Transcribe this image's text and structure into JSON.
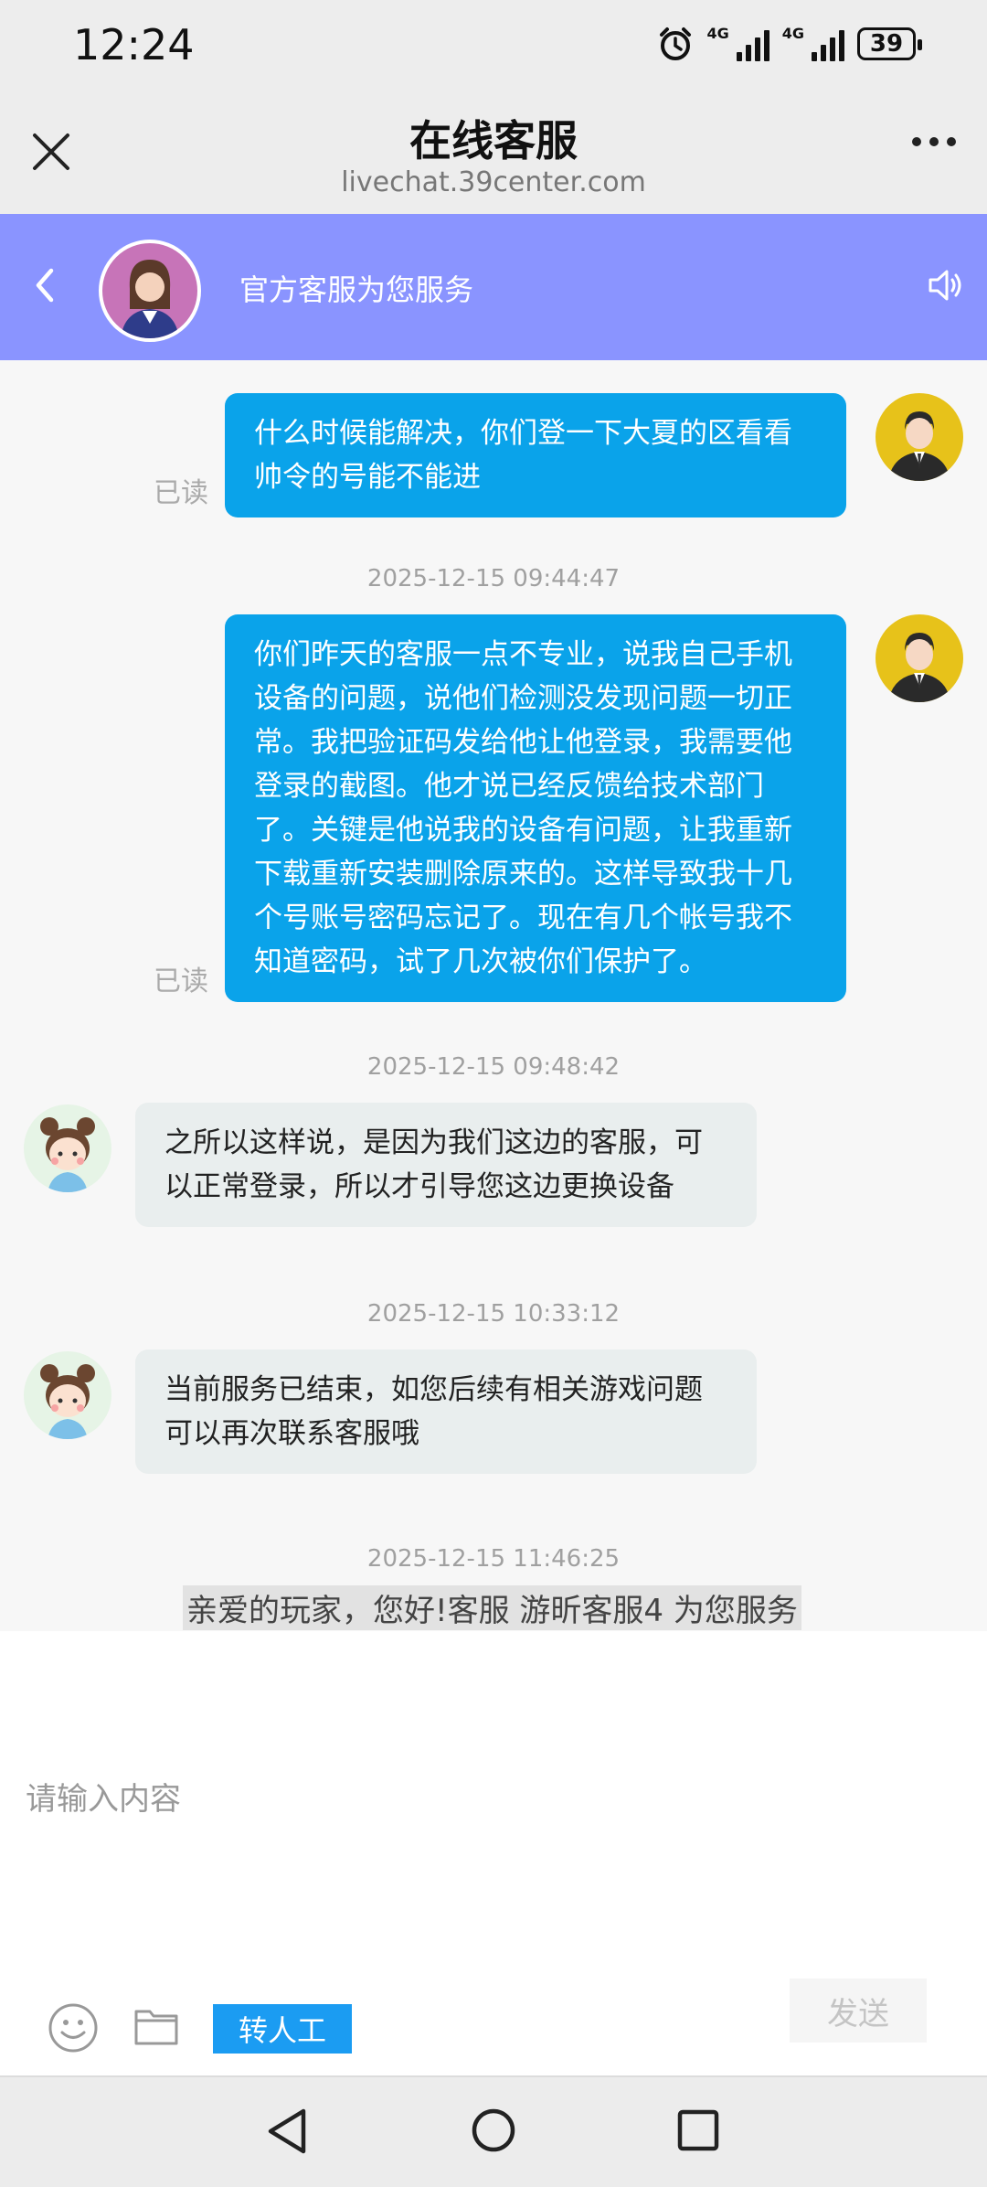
{
  "status_bar": {
    "time": "12:24",
    "network_1": "4G",
    "network_2": "4G",
    "battery": "39"
  },
  "browser": {
    "title": "在线客服",
    "url": "livechat.39center.com"
  },
  "chat_header": {
    "title": "官方客服为您服务"
  },
  "messages": [
    {
      "from": "user",
      "text": "什么时候能解决，你们登一下大夏的区看看帅令的号能不能进",
      "status": "已读"
    },
    {
      "timestamp": "2025-12-15 09:44:47"
    },
    {
      "from": "user",
      "text": "你们昨天的客服一点不专业，说我自己手机设备的问题，说他们检测没发现问题一切正常。我把验证码发给他让他登录，我需要他登录的截图。他才说已经反馈给技术部门了。关键是他说我的设备有问题，让我重新下载重新安装删除原来的。这样导致我十几个号账号密码忘记了。现在有几个帐号我不知道密码，试了几次被你们保护了。",
      "status": "已读"
    },
    {
      "timestamp": "2025-12-15 09:48:42"
    },
    {
      "from": "agent",
      "text": "之所以这样说，是因为我们这边的客服，可以正常登录，所以才引导您这边更换设备"
    },
    {
      "timestamp": "2025-12-15 10:33:12"
    },
    {
      "from": "agent",
      "text": "当前服务已结束，如您后续有相关游戏问题可以再次联系客服哦"
    },
    {
      "timestamp": "2025-12-15 11:46:25"
    },
    {
      "system": "亲爱的玩家，您好!客服 游昕客服4 为您服务"
    }
  ],
  "input": {
    "placeholder": "请输入内容",
    "transfer_label": "转人工",
    "send_label": "发送"
  },
  "colors": {
    "header_bg": "#8a94ff",
    "user_bubble": "#0aa3ea",
    "agent_bubble": "#e9eeee",
    "transfer_btn": "#1b9cf2"
  },
  "icons": [
    "close-icon",
    "more-icon",
    "back-icon",
    "speaker-icon",
    "emoji-icon",
    "folder-icon",
    "nav-back-icon",
    "nav-home-icon",
    "nav-recents-icon"
  ]
}
